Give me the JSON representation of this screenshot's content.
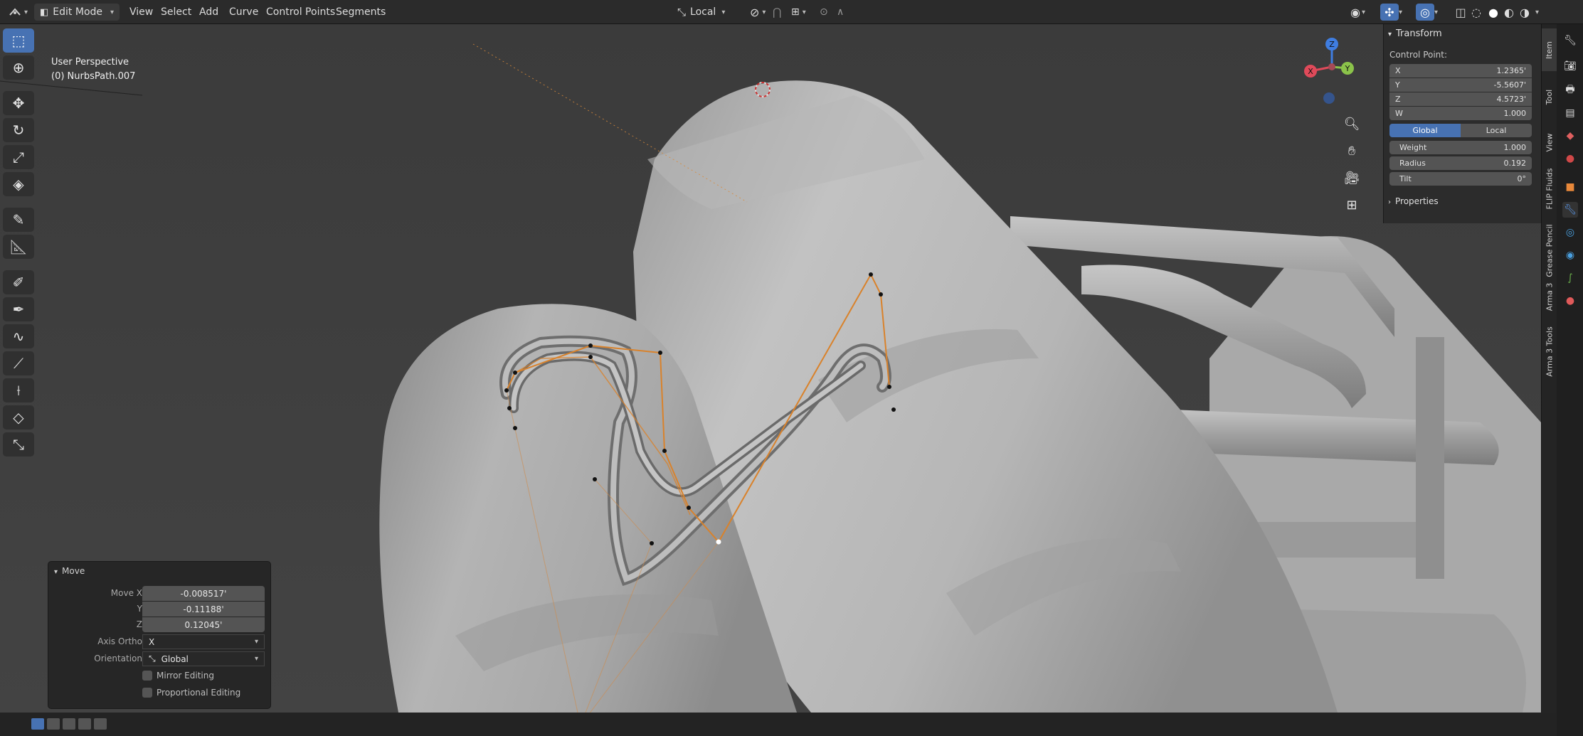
{
  "header": {
    "mode": "Edit Mode",
    "menus": [
      "View",
      "Select",
      "Add",
      "Curve",
      "Control Points",
      "Segments"
    ],
    "pivot": "Local"
  },
  "viewport": {
    "perspective": "User Perspective",
    "object": "(0) NurbsPath.007"
  },
  "npanel": {
    "section": "Transform",
    "control_point_label": "Control Point:",
    "coords": [
      {
        "label": "X",
        "value": "1.2365'"
      },
      {
        "label": "Y",
        "value": "-5.5607'"
      },
      {
        "label": "Z",
        "value": "4.5723'"
      },
      {
        "label": "W",
        "value": "1.000"
      }
    ],
    "space_global": "Global",
    "space_local": "Local",
    "weight_label": "Weight",
    "weight_value": "1.000",
    "radius_label": "Radius",
    "radius_value": "0.192",
    "tilt_label": "Tilt",
    "tilt_value": "0°",
    "properties": "Properties"
  },
  "vtabs": [
    "Item",
    "Tool",
    "View",
    "FLIP Fluids",
    "Grease Pencil",
    "Arma 3",
    "Arma 3 Tools"
  ],
  "operator": {
    "title": "Move",
    "move_x_label": "Move X",
    "move_x": "-0.008517'",
    "y_label": "Y",
    "move_y": "-0.11188'",
    "z_label": "Z",
    "move_z": "0.12045'",
    "axis_ortho_label": "Axis Ortho",
    "axis_ortho": "X",
    "orientation_label": "Orientation",
    "orientation": "Global",
    "mirror": "Mirror Editing",
    "proportional": "Proportional Editing"
  },
  "colors": {
    "accent": "#4772b3",
    "curve_edges": "#d9822b",
    "axis_x": "#e04a5a",
    "axis_y": "#8bc34a",
    "axis_z": "#3f7de0"
  },
  "icons": {
    "toolbar": [
      "select-box-icon",
      "cursor-icon",
      "move-icon",
      "rotate-icon",
      "scale-icon",
      "transform-icon",
      "annotate-icon",
      "measure-icon",
      "draw-icon",
      "pen-icon",
      "curve-draw-icon",
      "extrude-icon",
      "radius-icon",
      "tilt-icon",
      "randomize-icon"
    ]
  }
}
